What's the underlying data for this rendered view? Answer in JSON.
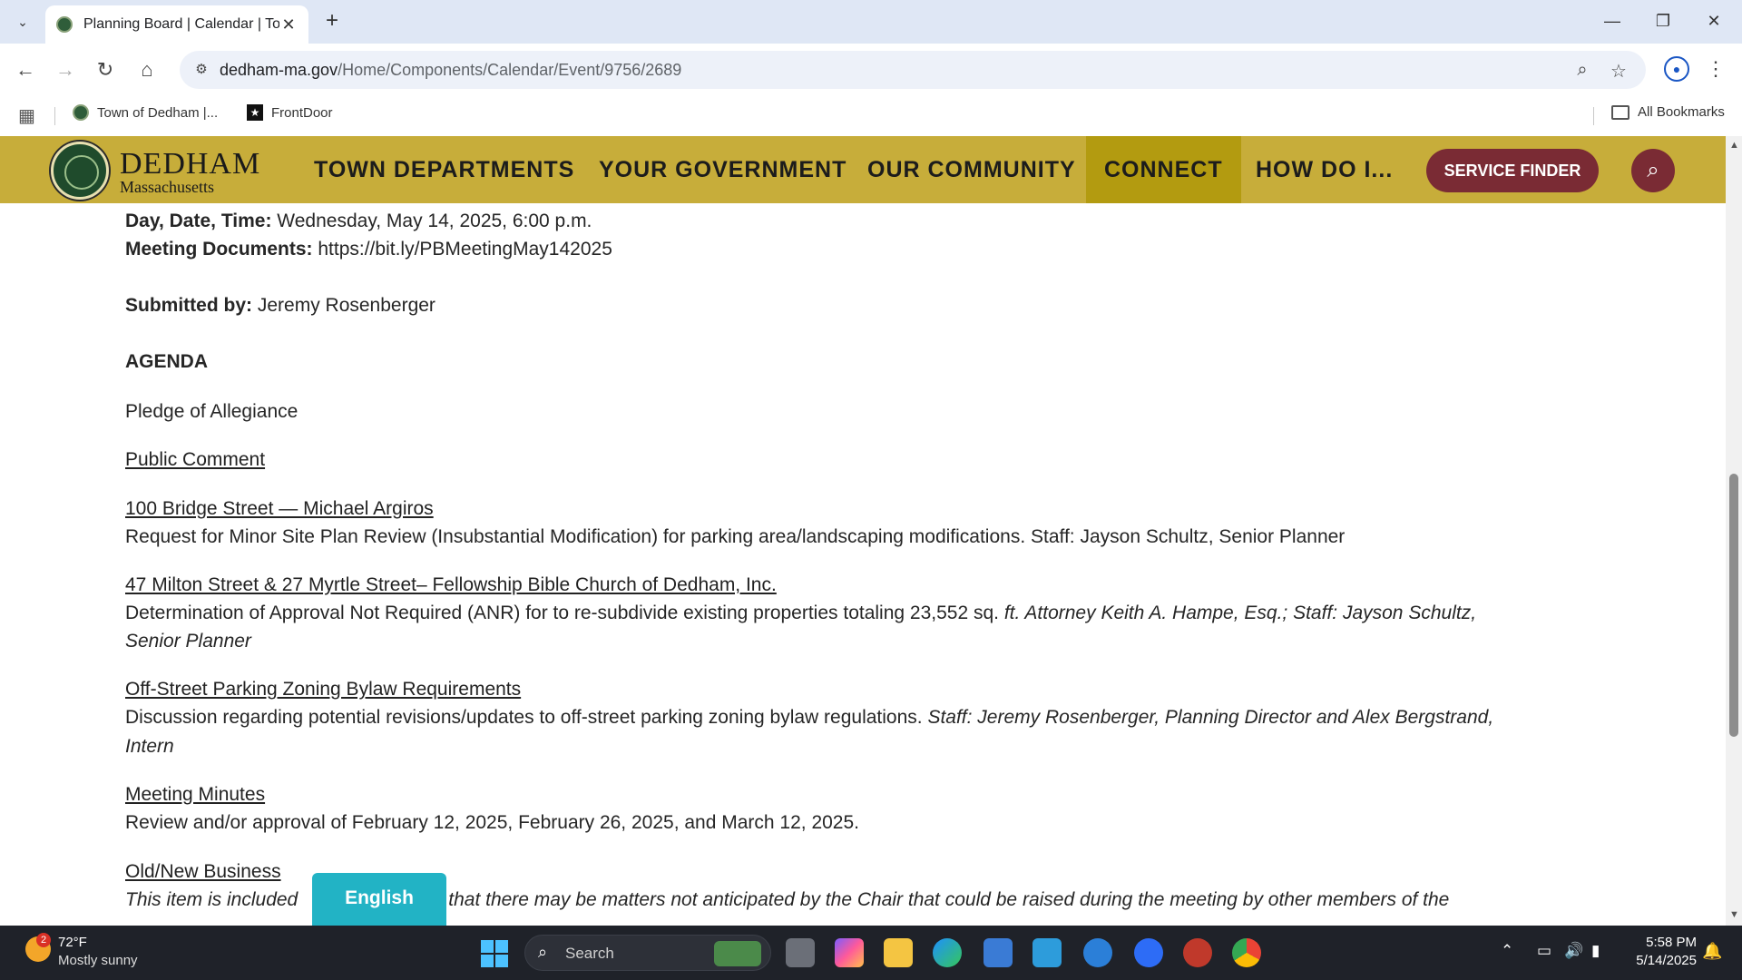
{
  "browser": {
    "tab_title": "Planning Board | Calendar | Tow",
    "tab_close": "✕",
    "new_tab": "+",
    "url_host": "dedham-ma.gov",
    "url_path": "/Home/Components/Calendar/Event/9756/2689",
    "bookmarks": [
      {
        "label": "Town of Dedham |...",
        "icon": "dedham-seal-icon"
      },
      {
        "label": "FrontDoor",
        "icon": "frontdoor-icon"
      }
    ],
    "all_bookmarks": "All Bookmarks"
  },
  "site": {
    "logo_name": "DEDHAM",
    "logo_sub": "Massachusetts",
    "nav": [
      "TOWN DEPARTMENTS",
      "YOUR GOVERNMENT",
      "OUR COMMUNITY",
      "CONNECT",
      "HOW DO I..."
    ],
    "service_finder": "SERVICE FINDER",
    "accent": "#c7ad3a",
    "button_color": "#7a2b34"
  },
  "event": {
    "day_label": "Day, Date, Time:",
    "day_value": "Wednesday, May 14, 2025, 6:00 p.m.",
    "docs_label": "Meeting Documents:",
    "docs_value": "https://bit.ly/PBMeetingMay142025",
    "submitted_label": "Submitted by:",
    "submitted_value": "Jeremy Rosenberger",
    "agenda_heading": "AGENDA",
    "pledge": "Pledge of Allegiance",
    "public_comment": "Public Comment",
    "item1_title": "100 Bridge Street — Michael Argiros",
    "item1_desc": "Request for Minor Site Plan Review (Insubstantial Modification) for parking area/landscaping modifications.  Staff: Jayson Schultz, Senior Planner",
    "item2_title": "47 Milton Street & 27 Myrtle Street– Fellowship Bible Church of Dedham, Inc.",
    "item2_desc_a": "Determination of Approval Not Required (ANR) for to re-subdivide existing properties totaling 23,552 sq. ",
    "item2_desc_b": "ft. Attorney Keith A. Hampe, Esq.; Staff: Jayson Schultz,",
    "item2_desc_c": "Senior Planner",
    "item3_title": "Off-Street Parking Zoning Bylaw Requirements",
    "item3_desc_a": "Discussion regarding potential revisions/updates to off-street parking zoning bylaw regulations. ",
    "item3_desc_b": "Staff: Jeremy Rosenberger, Planning Director and Alex Bergstrand,",
    "item3_desc_c": "Intern",
    "item4_title": "Meeting Minutes",
    "item4_desc": "Review and/or approval of February 12, 2025, February 26, 2025, and March 12, 2025.",
    "item5_title": "Old/New Business",
    "item5_desc_a": "This item is included",
    "item5_desc_b": "that there may be matters not anticipated by the Chair that could be raised during the meeting by other members of the"
  },
  "language_widget": "English",
  "taskbar": {
    "weather_temp": "72°F",
    "weather_desc": "Mostly sunny",
    "weather_badge": "2",
    "search_placeholder": "Search",
    "time": "5:58 PM",
    "date": "5/14/2025"
  }
}
